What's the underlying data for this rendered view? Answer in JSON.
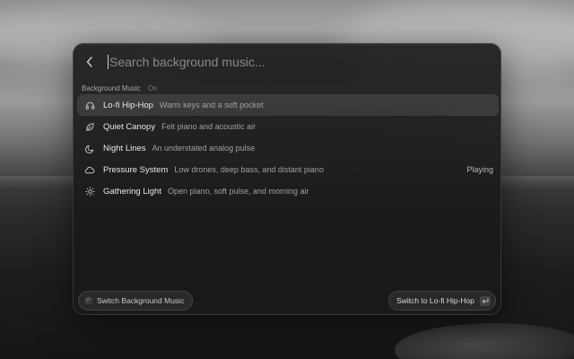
{
  "search": {
    "placeholder": "Search background music..."
  },
  "section": {
    "title": "Background Music",
    "status": "On"
  },
  "items": [
    {
      "name": "Lo-fi Hip-Hop",
      "description": "Warm keys and a soft pocket",
      "icon": "headphones-icon",
      "status": ""
    },
    {
      "name": "Quiet Canopy",
      "description": "Felt piano and acoustic air",
      "icon": "leaf-icon",
      "status": ""
    },
    {
      "name": "Night Lines",
      "description": "An understated analog pulse",
      "icon": "moon-icon",
      "status": ""
    },
    {
      "name": "Pressure System",
      "description": "Low drones, deep bass, and distant piano",
      "icon": "cloud-icon",
      "status": "Playing"
    },
    {
      "name": "Gathering Light",
      "description": "Open piano, soft pulse, and morning air",
      "icon": "sun-icon",
      "status": ""
    }
  ],
  "footer": {
    "left_label": "Switch Background Music",
    "right_label": "Switch to Lo-fi Hip-Hop",
    "enter_symbol": "↵"
  }
}
